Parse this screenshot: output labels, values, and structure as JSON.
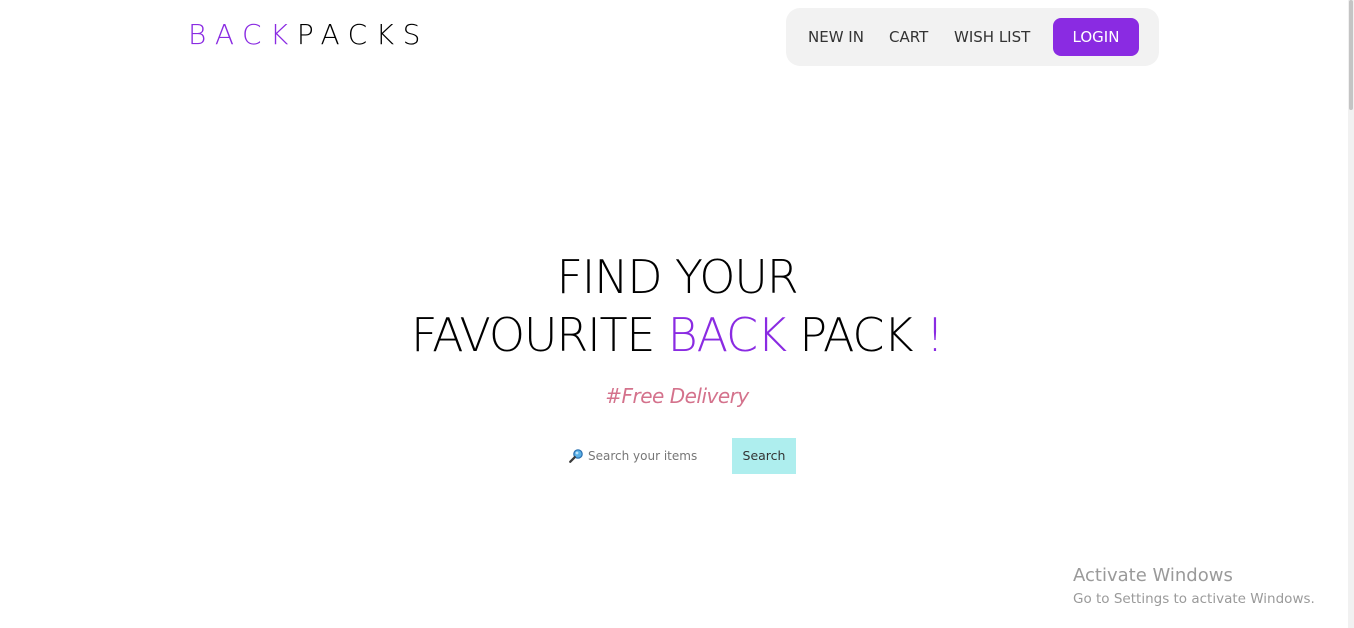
{
  "brand": {
    "part1": "BACK",
    "part2": "PACKS"
  },
  "nav": {
    "items": [
      {
        "label": "NEW IN"
      },
      {
        "label": "CART"
      },
      {
        "label": "WISH LIST"
      }
    ],
    "login_label": "LOGIN"
  },
  "hero": {
    "line1": "FIND YOUR",
    "line2_prefix": "FAVOURITE ",
    "line2_accent": "BACK",
    "line2_middle": " PACK ",
    "line2_mark": "!",
    "subtitle": "#Free Delivery"
  },
  "search": {
    "placeholder": "Search your items",
    "value": "",
    "button_label": "Search",
    "icon": "magnifier-icon"
  },
  "watermark": {
    "title": "Activate Windows",
    "subtitle": "Go to Settings to activate Windows."
  },
  "colors": {
    "accent": "#8a2be2",
    "subtitle": "#d4728c",
    "search_button": "#aeeeee",
    "nav_background": "#f2f2f2"
  }
}
